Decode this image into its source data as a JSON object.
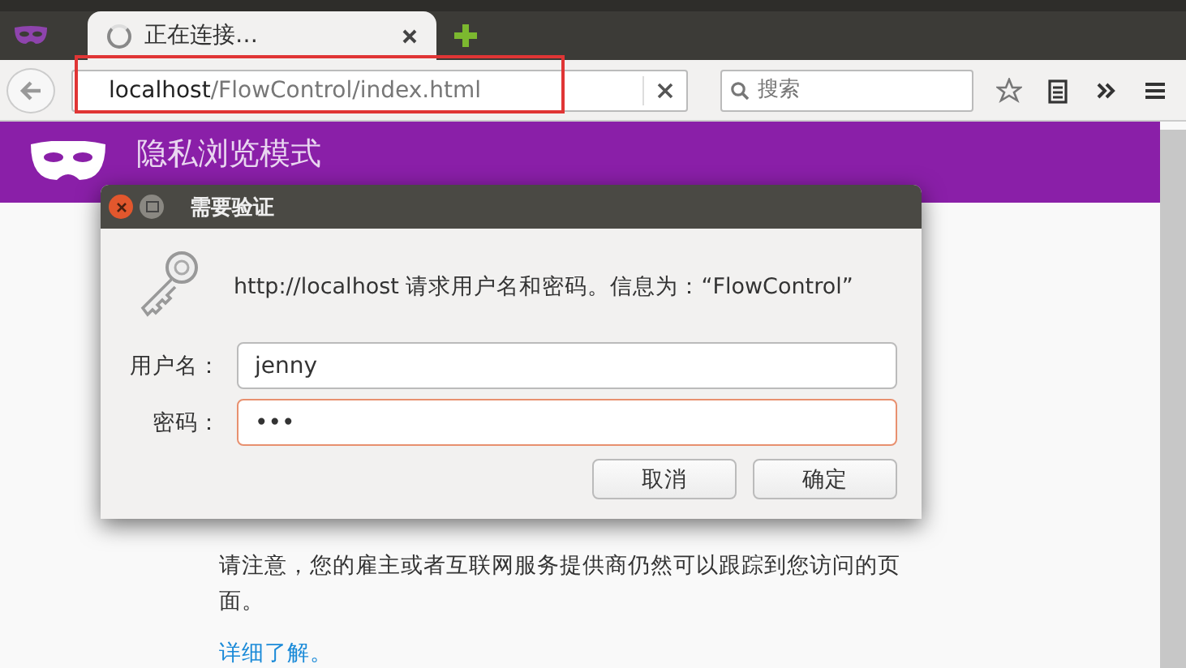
{
  "tabs": [
    {
      "label": "正在连接…",
      "selected": true,
      "loading": true
    }
  ],
  "address_bar": {
    "host": "localhost",
    "path": "/FlowControl/index.html",
    "highlighted": true
  },
  "search": {
    "placeholder": "搜索"
  },
  "banner": {
    "title": "隐私浏览模式"
  },
  "dialog": {
    "title": "需要验证",
    "message": "http://localhost 请求用户名和密码。信息为：“FlowControl”",
    "fields": [
      {
        "label": "用户名：",
        "value": "jenny",
        "focused": false
      },
      {
        "label": "密码：",
        "value": "•••",
        "focused": true
      }
    ],
    "buttons": [
      "取消",
      "确定"
    ]
  },
  "page": {
    "notice": "请注意，您的雇主或者互联网服务提供商仍然可以跟踪到您访问的页面。",
    "link": "详细了解。"
  }
}
